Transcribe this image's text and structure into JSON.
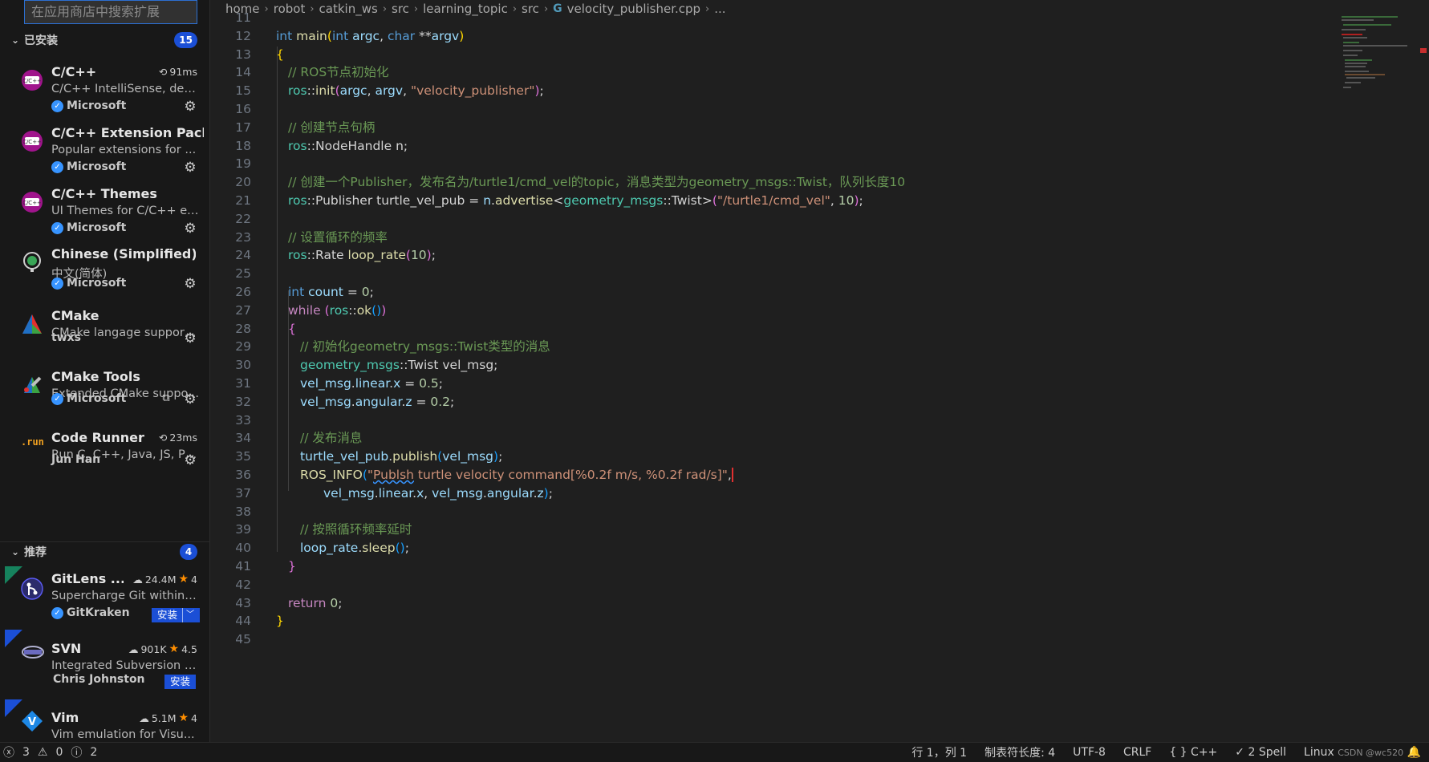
{
  "sidebar": {
    "search_placeholder": "在应用商店中搜索扩展",
    "installed": {
      "title": "已安装",
      "count": "15",
      "items": [
        {
          "name": "C/C++",
          "meta": "91ms",
          "desc": "C/C++ IntelliSense, deb...",
          "publisher": "Microsoft",
          "verified": true,
          "icon": "c-cpp-icon"
        },
        {
          "name": "C/C++ Extension Pack",
          "desc": "Popular extensions for ...",
          "publisher": "Microsoft",
          "verified": true,
          "icon": "c-cpp-icon"
        },
        {
          "name": "C/C++ Themes",
          "desc": "UI Themes for C/C++ ex...",
          "publisher": "Microsoft",
          "verified": true,
          "icon": "c-cpp-icon"
        },
        {
          "name": "Chinese (Simplified) (...",
          "desc": "中文(简体)",
          "publisher": "Microsoft",
          "verified": true,
          "icon": "globe-icon"
        },
        {
          "name": "CMake",
          "desc": "CMake langage support...",
          "publisher": "twxs",
          "verified": false,
          "icon": "cmake-icon"
        },
        {
          "name": "CMake Tools",
          "desc": "Extended CMake suppo...",
          "publisher": "Microsoft",
          "verified": true,
          "icon": "cmake-tools-icon"
        },
        {
          "name": "Code Runner",
          "meta": "23ms",
          "desc": "Run C, C++, Java, JS, PH...",
          "publisher": "Jun Han",
          "verified": false,
          "icon": "run-icon",
          "icon_text": ".run"
        }
      ]
    },
    "recommended": {
      "title": "推荐",
      "count": "4",
      "items": [
        {
          "name": "GitLens ...",
          "downloads": "24.4M",
          "rating": "4",
          "desc": "Supercharge Git within ...",
          "publisher": "GitKraken",
          "verified": true,
          "install": "安装",
          "icon": "gitlens-icon"
        },
        {
          "name": "SVN",
          "downloads": "901K",
          "rating": "4.5",
          "desc": "Integrated Subversion s...",
          "publisher": "Chris Johnston",
          "verified": false,
          "install": "安装",
          "icon": "svn-icon"
        },
        {
          "name": "Vim",
          "downloads": "5.1M",
          "rating": "4",
          "desc": "Vim emulation for Visu...",
          "icon": "vim-icon"
        }
      ]
    }
  },
  "breadcrumb": [
    "home",
    "robot",
    "catkin_ws",
    "src",
    "learning_topic",
    "src",
    "velocity_publisher.cpp",
    "..."
  ],
  "editor": {
    "line_numbers": [
      "11",
      "12",
      "13",
      "14",
      "15",
      "16",
      "17",
      "18",
      "19",
      "20",
      "21",
      "22",
      "23",
      "24",
      "25",
      "26",
      "27",
      "28",
      "29",
      "30",
      "31",
      "32",
      "33",
      "34",
      "35",
      "36",
      "37",
      "38",
      "39",
      "40",
      "41",
      "42",
      "43",
      "44",
      "45"
    ],
    "comments": {
      "c14": "// ROS节点初始化",
      "c17": "// 创建节点句柄",
      "c20": "// 创建一个Publisher，发布名为/turtle1/cmd_vel的topic，消息类型为geometry_msgs::Twist，队列长度10",
      "c23": "// 设置循环的频率",
      "c29": "// 初始化geometry_msgs::Twist类型的消息",
      "c34": "// 发布消息",
      "c39": "// 按照循环频率延时"
    },
    "strings": {
      "s15": "\"velocity_publisher\"",
      "s21": "\"/turtle1/cmd_vel\"",
      "s36a": "\"",
      "s36b": "Publsh",
      "s36c": " turtle velocity command[%0.2f m/s, %0.2f rad/s]\""
    },
    "numbers": {
      "n21": "10",
      "n24": "10",
      "n26": "0",
      "n31": "0.5",
      "n32": "0.2",
      "n43": "0"
    }
  },
  "statusbar": {
    "errors": "3",
    "warnings": "0",
    "info": "2",
    "position": "行 1，列 1",
    "tab_size": "制表符长度: 4",
    "encoding": "UTF-8",
    "eol": "CRLF",
    "language": "C++",
    "spell": "2 Spell",
    "os": "Linux",
    "watermark": "CSDN @wc520"
  },
  "colors": {
    "accent": "#1b4fd6",
    "verified": "#3794ff",
    "star": "#ff8e00"
  }
}
